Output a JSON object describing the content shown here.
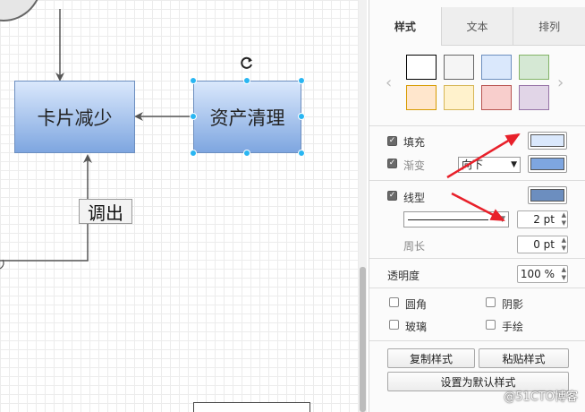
{
  "canvas": {
    "node_left_label": "卡片减少",
    "node_right_label": "资产清理",
    "edge_label": "调出"
  },
  "panel": {
    "tabs": [
      {
        "label": "样式",
        "active": true
      },
      {
        "label": "文本",
        "active": false
      },
      {
        "label": "排列",
        "active": false
      }
    ],
    "swatches": [
      {
        "fill": "#ffffff",
        "stroke": "#000000"
      },
      {
        "fill": "#f5f5f5",
        "stroke": "#666666"
      },
      {
        "fill": "#dae8fc",
        "stroke": "#6c8ebf"
      },
      {
        "fill": "#d5e8d4",
        "stroke": "#82b366"
      },
      {
        "fill": "#ffe6cc",
        "stroke": "#d79b00"
      },
      {
        "fill": "#fff2cc",
        "stroke": "#d6b656"
      },
      {
        "fill": "#f8cecc",
        "stroke": "#b85450"
      },
      {
        "fill": "#e1d5e7",
        "stroke": "#9673a6"
      }
    ],
    "fill": {
      "label": "填充",
      "checked": true,
      "color": "#dae8fc"
    },
    "gradient": {
      "label": "渐变",
      "checked": true,
      "direction": "向下",
      "color": "#7ea6e0"
    },
    "line": {
      "label": "线型",
      "checked": true,
      "color": "#6c8ebf",
      "width": "2 pt"
    },
    "perimeter": {
      "label": "周长",
      "value": "0 pt"
    },
    "opacity": {
      "label": "透明度",
      "value": "100 %"
    },
    "options": {
      "rounded": {
        "label": "圆角",
        "checked": false
      },
      "shadow": {
        "label": "阴影",
        "checked": false
      },
      "glass": {
        "label": "玻璃",
        "checked": false
      },
      "sketch": {
        "label": "手绘",
        "checked": false
      }
    },
    "buttons": {
      "copy_style": "复制样式",
      "paste_style": "粘贴样式",
      "set_default": "设置为默认样式"
    }
  },
  "watermark": "@51CTO博客",
  "colors": {
    "handle": "#29b6f2",
    "annotation_arrow": "#e8202a",
    "edge": "#555555"
  }
}
